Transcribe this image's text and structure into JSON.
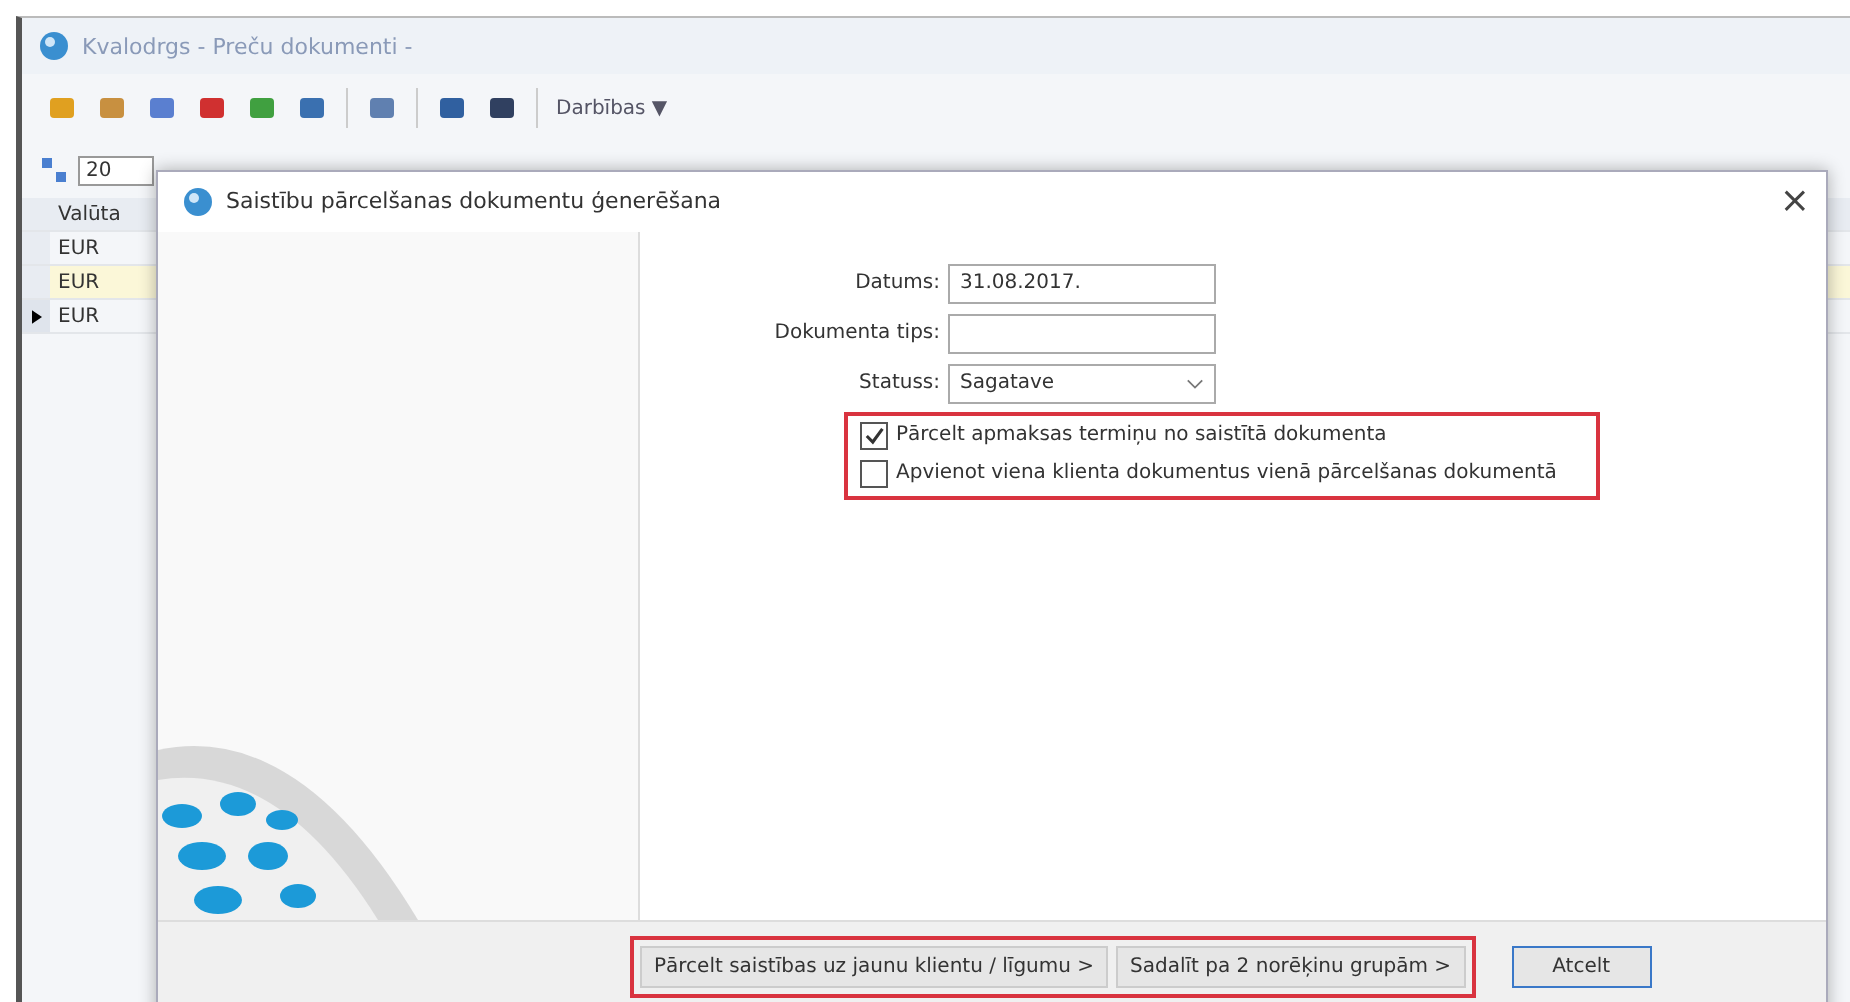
{
  "app_window": {
    "title": "Kvalodrgs - Preču dokumenti -",
    "toolbar": {
      "menu": "Darbības ▼"
    },
    "filter": {
      "value": "20"
    },
    "table": {
      "columns": [
        "Valūta"
      ],
      "rows": [
        {
          "cells": [
            "EUR"
          ],
          "selected": false,
          "highlighted": false
        },
        {
          "cells": [
            "EUR"
          ],
          "selected": false,
          "highlighted": true
        },
        {
          "cells": [
            "EUR"
          ],
          "selected": true,
          "highlighted": false
        }
      ]
    }
  },
  "dialog": {
    "title": "Saistību pārcelšanas dokumentu ģenerēšana",
    "close": "×",
    "fields": [
      {
        "kind": "text",
        "label": "Datums:",
        "value": "31.08.2017."
      },
      {
        "kind": "text",
        "label": "Dokumenta tips:"
      },
      {
        "kind": "select",
        "label": "Statuss:",
        "value": "Sagatave"
      }
    ],
    "checkboxes": [
      {
        "label": "Pārcelt apmaksas termiņu no saistītā dokumenta",
        "checked": true
      },
      {
        "label": "Apvienot viena klienta dokumentus vienā pārcelšanas dokumentā",
        "checked": false
      }
    ],
    "buttons": [
      {
        "label": "Pārcelt saistības uz jaunu klientu / līgumu >",
        "kind": "highlighted"
      },
      {
        "label": "Sadalīt pa 2 norēķinu grupām >",
        "kind": "highlighted"
      },
      {
        "label": "Atcelt",
        "kind": "default"
      }
    ]
  }
}
